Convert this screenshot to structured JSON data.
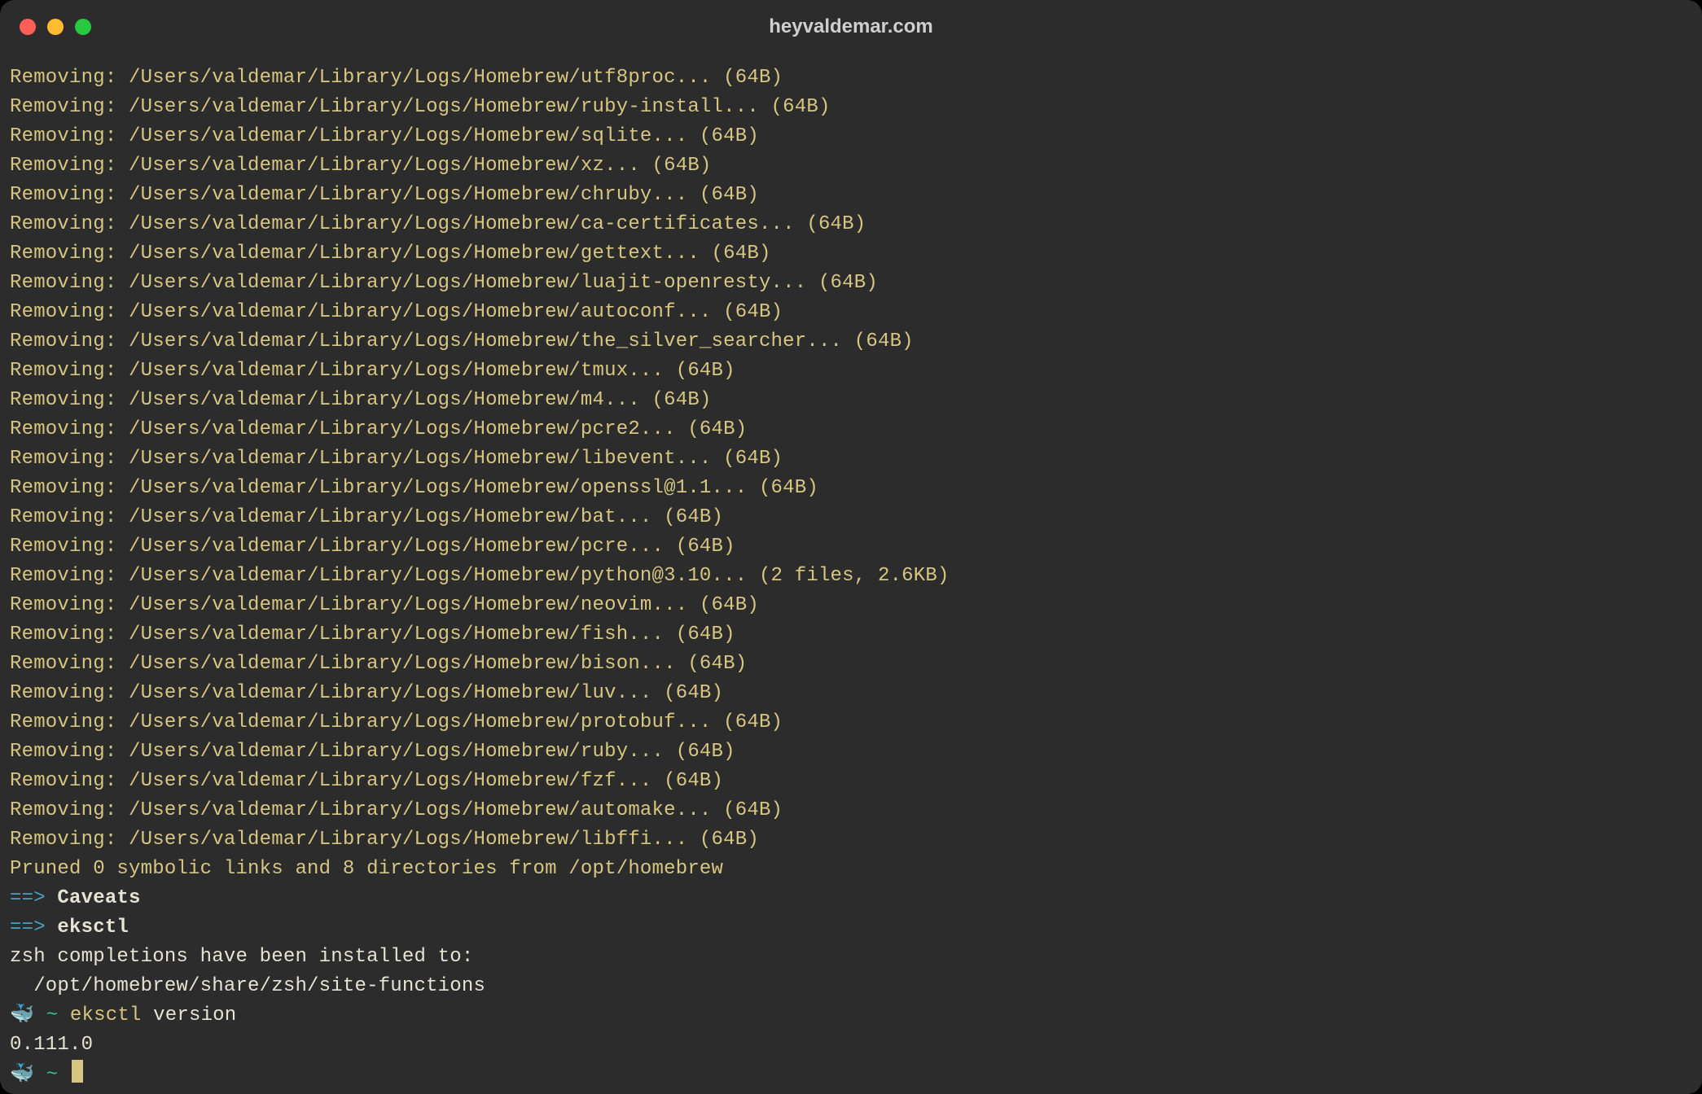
{
  "window": {
    "title": "heyvaldemar.com"
  },
  "log_prefix": "Removing: ",
  "log_base": "/Users/valdemar/Library/Logs/Homebrew/",
  "log_suffix_default": "... (64B)",
  "logs": [
    {
      "name": "utf8proc",
      "suffix": "... (64B)"
    },
    {
      "name": "ruby-install",
      "suffix": "... (64B)"
    },
    {
      "name": "sqlite",
      "suffix": "... (64B)"
    },
    {
      "name": "xz",
      "suffix": "... (64B)"
    },
    {
      "name": "chruby",
      "suffix": "... (64B)"
    },
    {
      "name": "ca-certificates",
      "suffix": "... (64B)"
    },
    {
      "name": "gettext",
      "suffix": "... (64B)"
    },
    {
      "name": "luajit-openresty",
      "suffix": "... (64B)"
    },
    {
      "name": "autoconf",
      "suffix": "... (64B)"
    },
    {
      "name": "the_silver_searcher",
      "suffix": "... (64B)"
    },
    {
      "name": "tmux",
      "suffix": "... (64B)"
    },
    {
      "name": "m4",
      "suffix": "... (64B)"
    },
    {
      "name": "pcre2",
      "suffix": "... (64B)"
    },
    {
      "name": "libevent",
      "suffix": "... (64B)"
    },
    {
      "name": "openssl@1.1",
      "suffix": "... (64B)"
    },
    {
      "name": "bat",
      "suffix": "... (64B)"
    },
    {
      "name": "pcre",
      "suffix": "... (64B)"
    },
    {
      "name": "python@3.10",
      "suffix": "... (2 files, 2.6KB)"
    },
    {
      "name": "neovim",
      "suffix": "... (64B)"
    },
    {
      "name": "fish",
      "suffix": "... (64B)"
    },
    {
      "name": "bison",
      "suffix": "... (64B)"
    },
    {
      "name": "luv",
      "suffix": "... (64B)"
    },
    {
      "name": "protobuf",
      "suffix": "... (64B)"
    },
    {
      "name": "ruby",
      "suffix": "... (64B)"
    },
    {
      "name": "fzf",
      "suffix": "... (64B)"
    },
    {
      "name": "automake",
      "suffix": "... (64B)"
    },
    {
      "name": "libffi",
      "suffix": "... (64B)"
    }
  ],
  "pruned": "Pruned 0 symbolic links and 8 directories from /opt/homebrew",
  "arrow": "==>",
  "sections": {
    "caveats": "Caveats",
    "eksctl": "eksctl"
  },
  "completions": {
    "line1": "zsh completions have been installed to:",
    "line2": "  /opt/homebrew/share/zsh/site-functions"
  },
  "prompt": {
    "whale": "🐳",
    "tilde": "~",
    "command": "eksctl",
    "arg": "version"
  },
  "version_output": "0.111.0"
}
